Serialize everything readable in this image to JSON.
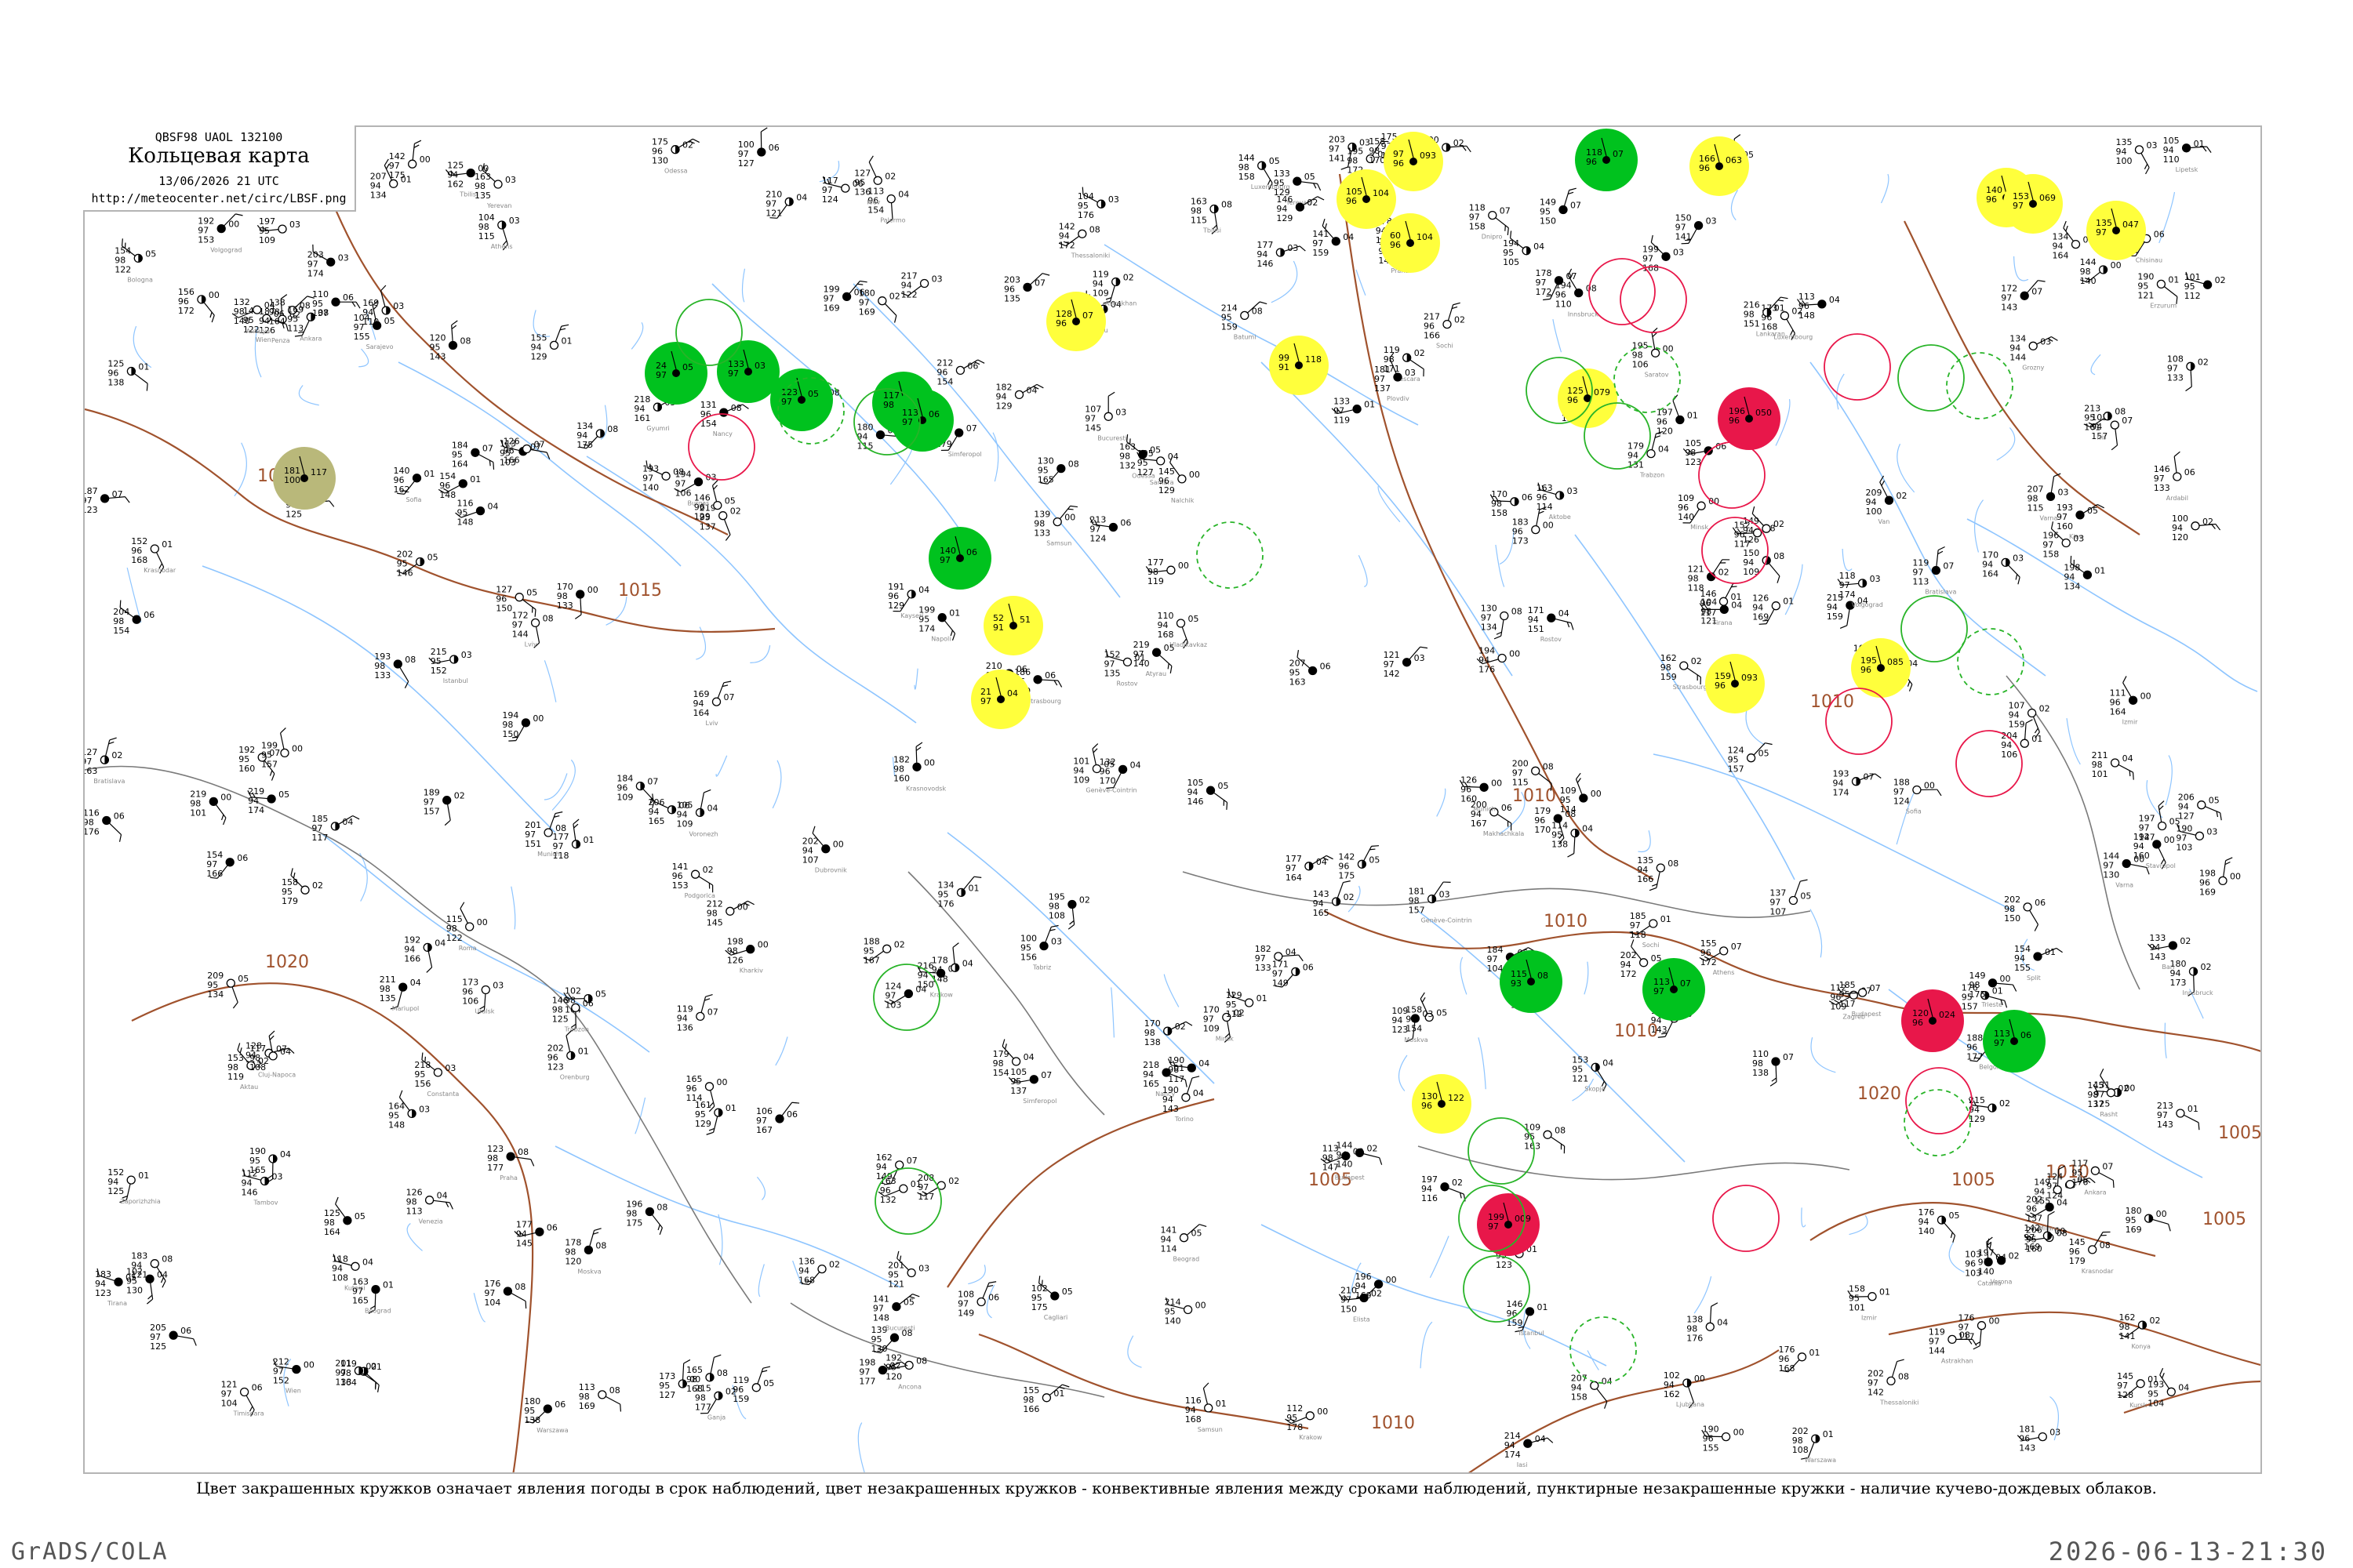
{
  "header": {
    "code_line": "QBSF98  UAOL  132100",
    "title": "Кольцевая карта",
    "date_line": "13/06/2026 21 UTC",
    "url": "http://meteocenter.net/circ/LBSF.png"
  },
  "legend_text": "Цвет закрашенных кружков означает явления погоды в срок наблюдений, цвет незакрашенных кружков - конвективные явления между сроками наблюдений, пунктирные незакрашенные кружки - наличие кучево-дождевых облаков.",
  "footer": {
    "left": "GrADS/COLA",
    "right": "2026-06-13-21:30"
  },
  "colors": {
    "isobar": "#a0522d",
    "river": "#8ec5ff",
    "filled_green": "#00c21e",
    "filled_yellow": "#ffff3c",
    "filled_red": "#e8174a",
    "filled_olive": "#b9b87a",
    "ring_green": "#28b428",
    "ring_red": "#e8174a"
  },
  "isobar_labels": [
    {
      "text": "1015"
    },
    {
      "text": "1020"
    },
    {
      "text": "1015"
    },
    {
      "text": "1010"
    },
    {
      "text": "1010"
    },
    {
      "text": "1010"
    },
    {
      "text": "1005"
    },
    {
      "text": "1010"
    },
    {
      "text": "1005"
    },
    {
      "text": "1005"
    },
    {
      "text": "1005"
    },
    {
      "text": "1010"
    },
    {
      "text": "1020"
    },
    {
      "text": "1010"
    }
  ],
  "highlighted_stations": [
    {
      "kind": "filled",
      "color": "green",
      "values": [
        "24",
        "97",
        "05"
      ]
    },
    {
      "kind": "filled",
      "color": "green",
      "values": [
        "123",
        "97",
        "05"
      ]
    },
    {
      "kind": "filled",
      "color": "green",
      "values": [
        "117",
        "98",
        "08"
      ]
    },
    {
      "kind": "filled",
      "color": "green",
      "values": [
        "113",
        "97",
        "06"
      ]
    },
    {
      "kind": "filled",
      "color": "green",
      "values": [
        "140",
        "97",
        "06"
      ]
    },
    {
      "kind": "filled",
      "color": "green",
      "values": [
        "118",
        "96",
        "07"
      ]
    },
    {
      "kind": "filled",
      "color": "green",
      "values": [
        "115",
        "93",
        "08"
      ]
    },
    {
      "kind": "filled",
      "color": "green",
      "values": [
        "113",
        "97",
        "07"
      ]
    },
    {
      "kind": "filled",
      "color": "green",
      "values": [
        "113",
        "97",
        "06"
      ]
    },
    {
      "kind": "filled",
      "color": "green",
      "values": [
        "133",
        "97",
        "03"
      ]
    },
    {
      "kind": "filled",
      "color": "yellow",
      "values": [
        "52",
        "91",
        "51"
      ]
    },
    {
      "kind": "filled",
      "color": "yellow",
      "values": [
        "21",
        "97",
        "04"
      ]
    },
    {
      "kind": "filled",
      "color": "yellow",
      "values": [
        "128",
        "96",
        "07"
      ]
    },
    {
      "kind": "filled",
      "color": "yellow",
      "values": [
        "99",
        "91",
        "118"
      ]
    },
    {
      "kind": "filled",
      "color": "yellow",
      "values": [
        "105",
        "96",
        "104"
      ]
    },
    {
      "kind": "filled",
      "color": "yellow",
      "values": [
        "97",
        "96",
        "093"
      ]
    },
    {
      "kind": "filled",
      "color": "yellow",
      "values": [
        "60",
        "96",
        "104"
      ]
    },
    {
      "kind": "filled",
      "color": "yellow",
      "values": [
        "125",
        "96",
        "079"
      ]
    },
    {
      "kind": "filled",
      "color": "yellow",
      "values": [
        "166",
        "96",
        "063"
      ]
    },
    {
      "kind": "filled",
      "color": "yellow",
      "values": [
        "140",
        "96",
        "057"
      ]
    },
    {
      "kind": "filled",
      "color": "yellow",
      "values": [
        "153",
        "97",
        "069"
      ]
    },
    {
      "kind": "filled",
      "color": "yellow",
      "values": [
        "135",
        "97",
        "047"
      ]
    },
    {
      "kind": "filled",
      "color": "yellow",
      "values": [
        "159",
        "96",
        "093"
      ]
    },
    {
      "kind": "filled",
      "color": "yellow",
      "values": [
        "195",
        "96",
        "085"
      ]
    },
    {
      "kind": "filled",
      "color": "yellow",
      "values": [
        "130",
        "96",
        "122"
      ]
    },
    {
      "kind": "filled",
      "color": "red",
      "values": [
        "196",
        "96",
        "050"
      ]
    },
    {
      "kind": "filled",
      "color": "red",
      "values": [
        "120",
        "96",
        "024"
      ]
    },
    {
      "kind": "filled",
      "color": "red",
      "values": [
        "199",
        "97",
        "009"
      ]
    },
    {
      "kind": "filled",
      "color": "olive",
      "values": [
        "181",
        "100",
        "117"
      ]
    }
  ],
  "station_labels": [
    "Luxembourg",
    "Strasbourg",
    "Nancy",
    "Genève-Cointrin",
    "Innsbruck",
    "Munich",
    "Wien",
    "Bratislava",
    "Budapest",
    "Beograd",
    "Bucuresti",
    "Sofia",
    "Varna",
    "Istanbul",
    "Ankara",
    "Kiev",
    "Minsk",
    "Moskva",
    "Praha",
    "Krakow",
    "Warszawa",
    "Lviv",
    "Odessa",
    "Simferopol",
    "Rostov",
    "Volgograd",
    "Astrakhan",
    "Tbilisi",
    "Yerevan",
    "Sochi",
    "Krasnodar",
    "Samsun",
    "Trabzon",
    "Izmir",
    "Athens",
    "Thessaloniki",
    "Skopje",
    "Tirana",
    "Podgorica",
    "Sarajevo",
    "Zagreb",
    "Ljubljana",
    "Roma",
    "Napoli",
    "Bari",
    "Cagliari",
    "Palermo",
    "Catania",
    "Pescara",
    "Ancona",
    "Bologna",
    "Milano",
    "Torino",
    "Verona",
    "Venezia",
    "Trieste",
    "Split",
    "Dubrovnik",
    "Chisinau",
    "Constanta",
    "Burgas",
    "Plovdiv",
    "Niš",
    "Timisoara",
    "Cluj-Napoca",
    "Iasi",
    "Kharkiv",
    "Dnipro",
    "Zaporizhzhia",
    "Mariupol",
    "Voronezh",
    "Kursk",
    "Belgorod",
    "Tambov",
    "Lipetsk",
    "Penza",
    "Saratov",
    "Samara",
    "Orenburg",
    "Atyrau",
    "Aktau",
    "Baku",
    "Makhachkala",
    "Grozny",
    "Vladikavkaz",
    "Nalchik",
    "Stavropol",
    "Elista",
    "Antalya",
    "Konya",
    "Kayseri",
    "Erzurum",
    "Van",
    "Batumi",
    "Kutaisi",
    "Gyumri",
    "Ganja",
    "Lankaran",
    "Tabriz",
    "Ardabil",
    "Rasht",
    "Krasnovodsk",
    "Uralsk",
    "Aktobe",
    "Kostanay"
  ]
}
